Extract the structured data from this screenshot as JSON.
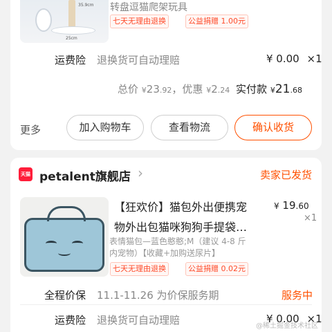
{
  "order1": {
    "product_subtitle": "转盘逗猫爬架玩具",
    "thumb_dim_top": "35.9cm",
    "thumb_dim_bottom": "25cm",
    "badges": [
      "七天无理由退换",
      "公益捐赠 1.00元"
    ],
    "insurance_label": "运费险",
    "insurance_desc": "退换货可自动理赔",
    "insurance_price": "¥ 0.00",
    "insurance_qty": "×1",
    "summary": {
      "total_label": "总价",
      "total_currency": "¥",
      "total_int": "23",
      "total_dec": ".92",
      "discount_label": "，优惠",
      "discount_currency": "¥",
      "discount_int": "2",
      "discount_dec": ".24",
      "paid_label": "实付款",
      "paid_currency": "¥",
      "paid_int": "21",
      "paid_dec": ".68"
    },
    "more_label": "更多",
    "buttons": {
      "add_cart": "加入购物车",
      "logistics": "查看物流",
      "confirm": "确认收货"
    }
  },
  "order2": {
    "tmall_badge": "天猫",
    "shop_name": "petalent旗舰店",
    "chevron": "›",
    "status": "卖家已发货",
    "title_line1": "【狂欢价】猫包外出便携宠",
    "title_line2": "物外出包猫咪狗狗手提袋…",
    "price_currency": "¥",
    "price_int": "19",
    "price_dec": ".60",
    "qty": "×1",
    "sku_line1": "表情猫包—蓝色憨憨;M（建议 4-8 斤",
    "sku_line2": "内宠物）【收藏+加购送尿片】",
    "badges": [
      "七天无理由退换",
      "公益捐赠 0.02元"
    ],
    "protect_label": "全程价保",
    "protect_desc": "11.1-11.26 为价保服务期",
    "protect_status": "服务中",
    "insurance_label": "运费险",
    "insurance_desc": "退换货可自动理赔",
    "insurance_price": "¥ 0.00",
    "insurance_qty": "×1"
  },
  "watermark": "@稀土掘金技术社区",
  "colors": {
    "accent": "#ff5000",
    "badge_red": "#ff4c2b",
    "gray_text": "#888888",
    "tmall_red": "#ff1d3a"
  }
}
